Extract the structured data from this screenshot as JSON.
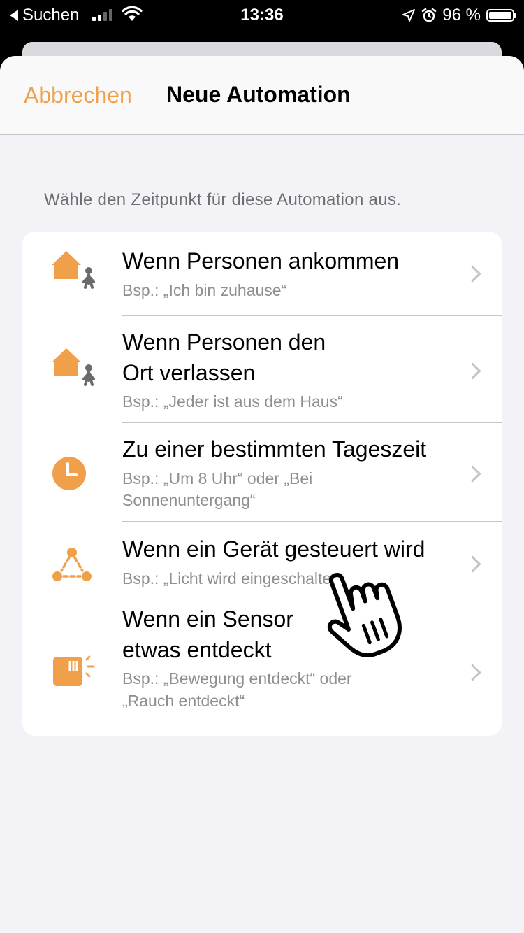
{
  "status_bar": {
    "back_label": "Suchen",
    "time": "13:36",
    "battery": "96 %",
    "battery_level": 0.96
  },
  "nav": {
    "cancel_label": "Abbrechen",
    "title": "Neue Automation"
  },
  "section_header": "Wähle den Zeitpunkt für diese Automation aus.",
  "items": [
    {
      "title1": "Wenn Personen ankommen",
      "title2": "",
      "sub1": "Bsp.: „Ich bin zuhause“",
      "sub2": "",
      "icon": "home-arrive-icon"
    },
    {
      "title1": "Wenn Personen den",
      "title2": "Ort verlassen",
      "sub1": "Bsp.: „Jeder ist aus dem Haus“",
      "sub2": "",
      "icon": "home-leave-icon"
    },
    {
      "title1": "Zu einer bestimmten Tageszeit",
      "title2": "",
      "sub1": "Bsp.: „Um 8 Uhr“ oder „Bei",
      "sub2": "Sonnenuntergang“",
      "icon": "clock-icon"
    },
    {
      "title1": "Wenn ein Gerät gesteuert wird",
      "title2": "",
      "sub1": "Bsp.: „Licht wird eingeschaltet“",
      "sub2": "",
      "icon": "accessory-triangle-icon"
    },
    {
      "title1": "Wenn ein Sensor",
      "title2": "etwas entdeckt",
      "sub1": "Bsp.: „Bewegung entdeckt“ oder",
      "sub2": "„Rauch entdeckt“",
      "icon": "sensor-icon"
    }
  ],
  "colors": {
    "accent": "#f0a04a",
    "background": "#f2f2f7",
    "icon_gray": "#6b6b6b"
  }
}
